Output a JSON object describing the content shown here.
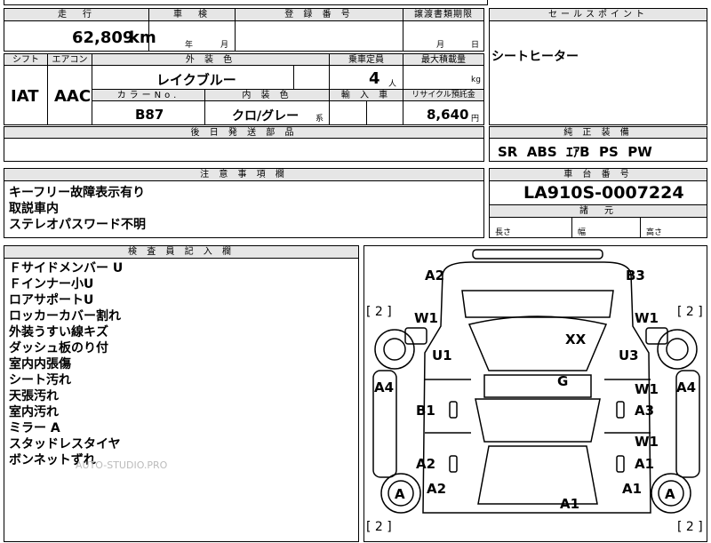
{
  "header": {
    "mileage_label": "走　行",
    "shaken_label": "車　検",
    "registration_label": "登 録 番 号",
    "transfer_label": "譲渡書類期限",
    "sales_point_label": "セールスポイント"
  },
  "values": {
    "mileage": "62,809",
    "mileage_unit": "km",
    "year_label": "年",
    "month_label": "月",
    "transfer_month_label": "月",
    "transfer_day_label": "日"
  },
  "row2": {
    "shift_label": "シフト",
    "aircon_label": "エアコン",
    "exterior_color_label": "外 装 色",
    "capacity_label": "乗車定員",
    "max_load_label": "最大積載量",
    "shift": "IAT",
    "aircon": "AAC",
    "exterior_color": "レイクブルー",
    "capacity": "4",
    "capacity_unit": "人",
    "max_load_unit": "kg",
    "color_no_label": "カラーNo.",
    "interior_color_label": "内 装 色",
    "import_label": "輸 入 車",
    "recycle_label": "リサイクル預託金",
    "color_no": "B87",
    "interior_color": "クロ/グレー",
    "interior_suffix": "系",
    "recycle_fee": "8,640",
    "recycle_unit": "円",
    "later_parts_label": "後 日 発 送 部 品"
  },
  "sales_point": {
    "text": "シートヒーター"
  },
  "equipment": {
    "label": "純 正 装 備",
    "items": "SR  ABS  ｴｱB  PS  PW"
  },
  "notes": {
    "label": "注 意 事 項 欄",
    "lines": [
      "キーフリー故障表示有り",
      "取説車内",
      "ステレオパスワード不明"
    ]
  },
  "chassis": {
    "label": "車 台 番 号",
    "number": "LA910S-0007224",
    "dims_label": "諸　元",
    "length_label": "長さ",
    "width_label": "幅",
    "height_label": "高さ"
  },
  "inspector": {
    "label": "検 査 員 記 入 欄",
    "lines": [
      "Ｆサイドメンバー U",
      "Ｆインナー小U",
      "ロアサポートU",
      "ロッカーカバー割れ",
      "外装うすい線キズ",
      "ダッシュ板のり付",
      "室内内張傷",
      "シート汚れ",
      "天張汚れ",
      "室内汚れ",
      "ミラー A",
      "スタッドレスタイヤ",
      "ボンネットずれ"
    ],
    "watermark": "AUTO-STUDIO.PRO"
  },
  "diagram": {
    "marks": {
      "a2_top": "A2",
      "b3_top": "B3",
      "w1_fl": "W1",
      "w1_fr": "W1",
      "xx": "XX",
      "u1": "U1",
      "u3": "U3",
      "a4_left": "A4",
      "a4_right": "A4",
      "g": "G",
      "w1_r1": "W1",
      "b1": "B1",
      "a3": "A3",
      "w1_r2": "W1",
      "a2_left": "A2",
      "a1_right": "A1",
      "a_left": "A",
      "a2_lower": "A2",
      "a1_center": "A1",
      "a1_lower_right": "A1",
      "a_right": "A",
      "bracket_tl": "[ 2 ]",
      "bracket_tr": "[ 2 ]",
      "bracket_bl": "[ 2 ]",
      "bracket_br": "[ 2 ]"
    }
  }
}
